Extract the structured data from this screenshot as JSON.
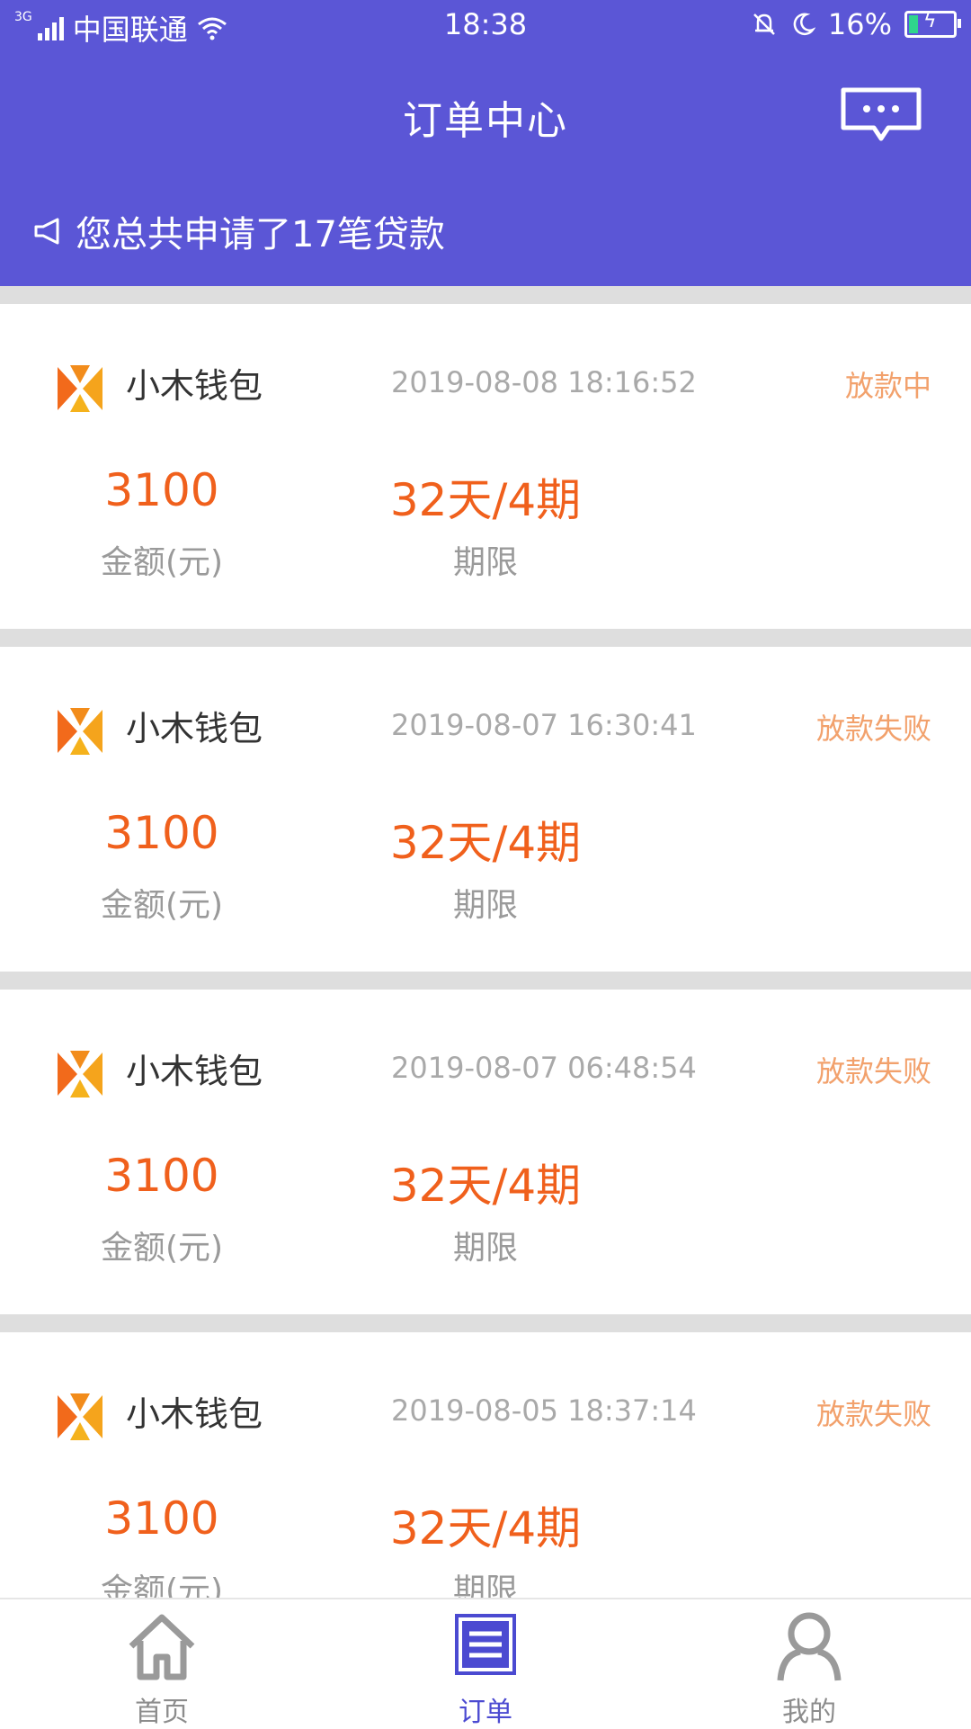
{
  "statusbar": {
    "network": "3G",
    "carrier": "中国联通",
    "time": "18:38",
    "battery": "16%"
  },
  "header": {
    "title": "订单中心",
    "notice": "您总共申请了17笔贷款"
  },
  "labels": {
    "amount": "金额(元)",
    "period": "期限"
  },
  "orders": [
    {
      "app": "小木钱包",
      "time": "2019-08-08 18:16:52",
      "status": "放款中",
      "amount": "3100",
      "period": "32天/4期"
    },
    {
      "app": "小木钱包",
      "time": "2019-08-07 16:30:41",
      "status": "放款失败",
      "amount": "3100",
      "period": "32天/4期"
    },
    {
      "app": "小木钱包",
      "time": "2019-08-07 06:48:54",
      "status": "放款失败",
      "amount": "3100",
      "period": "32天/4期"
    },
    {
      "app": "小木钱包",
      "time": "2019-08-05 18:37:14",
      "status": "放款失败",
      "amount": "3100",
      "period": "32天/4期"
    }
  ],
  "nav": {
    "items": [
      {
        "label": "首页",
        "icon": "home-icon"
      },
      {
        "label": "订单",
        "icon": "order-icon",
        "active": true
      },
      {
        "label": "我的",
        "icon": "user-icon"
      }
    ]
  },
  "colors": {
    "header_bg": "#5b56d6",
    "accent": "#f0601c",
    "status": "#f2a16c",
    "nav_active": "#4b4ad1"
  }
}
